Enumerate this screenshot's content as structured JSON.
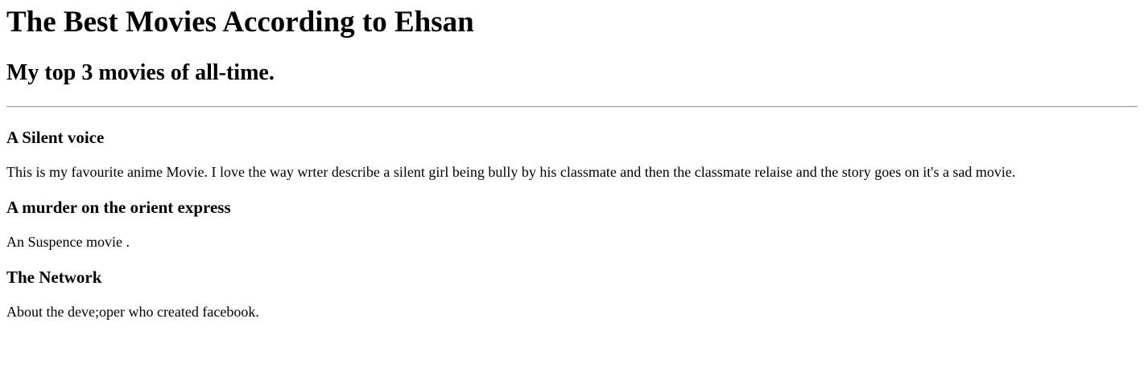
{
  "page": {
    "title": "The Best Movies According to Ehsan",
    "subtitle": "My top 3 movies of all-time."
  },
  "movies": [
    {
      "title": "A Silent voice",
      "description": "This is my favourite anime Movie. I love the way wrter describe a silent girl being bully by his classmate and then the classmate relaise and the story goes on it's a sad movie."
    },
    {
      "title": "A murder on the orient express",
      "description": "An Suspence movie ."
    },
    {
      "title": "The Network",
      "description": "About the deve;oper who created facebook."
    }
  ]
}
